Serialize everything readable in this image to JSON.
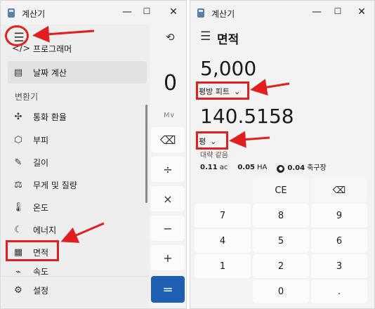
{
  "left": {
    "title": "계산기",
    "window_controls": [
      "—",
      "☐",
      "✕"
    ],
    "menu_icon": "☰",
    "history_icon": "⟲",
    "top_item_partial": "프로그래머",
    "date_calc": "날짜 계산",
    "section_label": "변환기",
    "items": [
      "통화 환율",
      "부피",
      "길이",
      "무게 및 질량",
      "온도",
      "에너지",
      "면적",
      "속도"
    ],
    "item_icons": [
      "✣",
      "⬡",
      "✎",
      "⚖",
      "🌡",
      "☾",
      "▦",
      "⌁"
    ],
    "settings": "설정",
    "settings_icon": "⚙",
    "behind": {
      "display": "0",
      "memory": "M∨",
      "buttons": [
        "⌫",
        "÷",
        "×",
        "−",
        "+"
      ],
      "equals": "="
    }
  },
  "right": {
    "title": "계산기",
    "window_controls": [
      "—",
      "☐",
      "✕"
    ],
    "menu_icon": "☰",
    "mode": "면적",
    "value_from": "5,000",
    "unit_from": "평방 피트",
    "value_to": "140.5158",
    "unit_to": "평",
    "approx_label": "대략 같음",
    "equivalents": [
      {
        "value": "0.11",
        "unit": "ac"
      },
      {
        "value": "0.05",
        "unit": "HA"
      },
      {
        "value": "0.04",
        "unit": "축구장"
      }
    ],
    "keypad": {
      "ce": "CE",
      "backspace": "⌫",
      "row1": [
        "7",
        "8",
        "9"
      ],
      "row2": [
        "4",
        "5",
        "6"
      ],
      "row3": [
        "1",
        "2",
        "3"
      ],
      "zero": "0",
      "dot": "."
    }
  },
  "highlight_color": "#e02020",
  "accent_color": "#1f60b5"
}
